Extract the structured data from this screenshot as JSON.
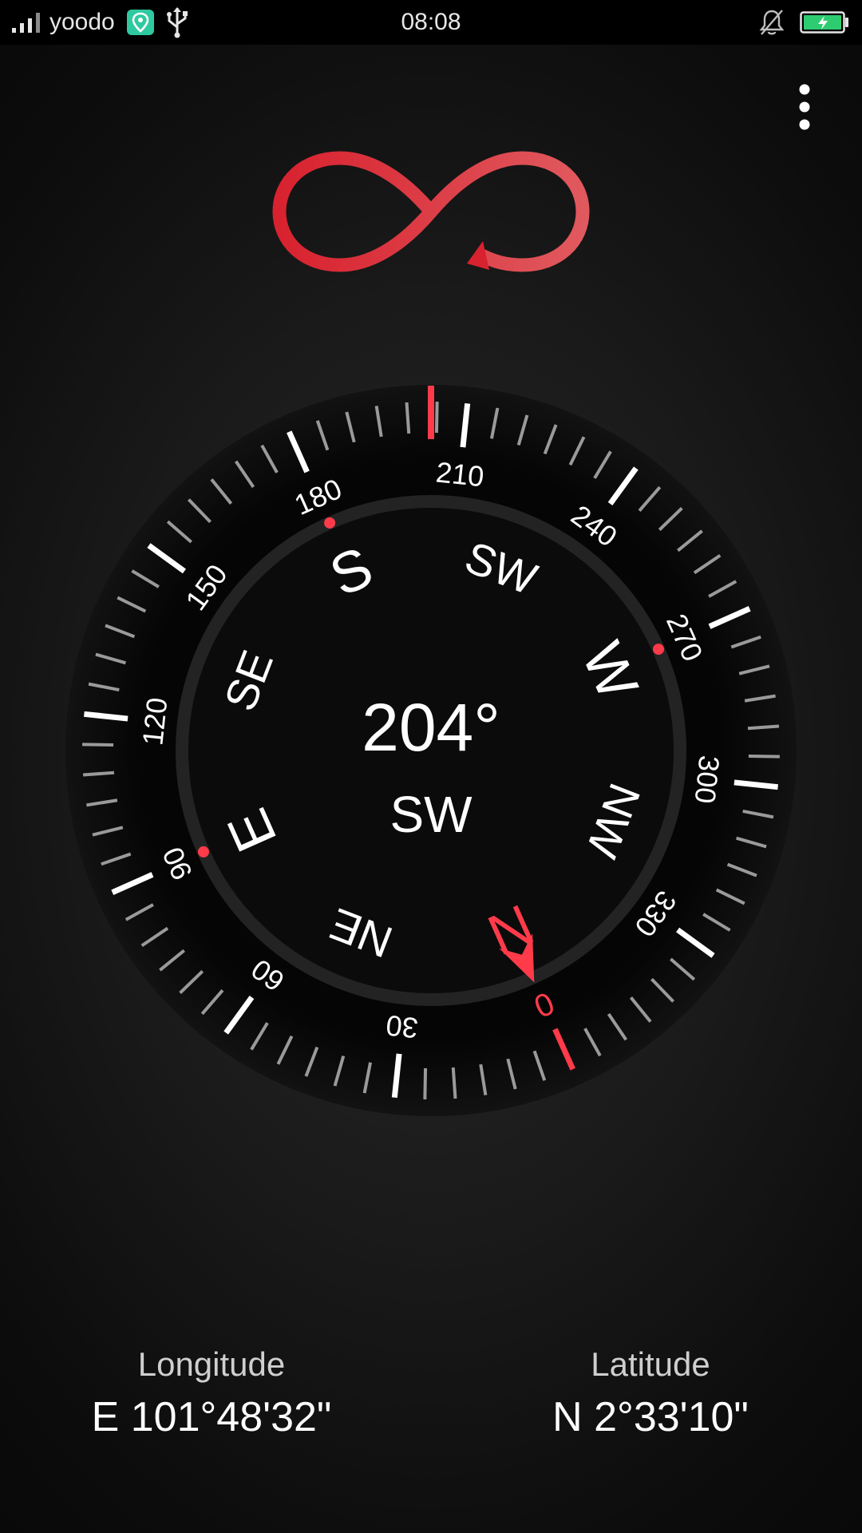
{
  "status_bar": {
    "carrier": "yoodo",
    "time": "08:08",
    "icons": [
      "signal-icon",
      "location-badge-icon",
      "usb-icon",
      "bell-off-icon",
      "battery-charging-icon"
    ],
    "battery_color": "#2ecc71"
  },
  "menu": {
    "icon": "more-vert-icon"
  },
  "logo": {
    "icon": "infinity-arrow-logo",
    "color": "#e0313f"
  },
  "compass": {
    "heading_degrees": 204,
    "heading_display": "204°",
    "direction": "SW",
    "accent_color": "#ff3b4a",
    "degree_labels": [
      "0",
      "30",
      "60",
      "90",
      "120",
      "150",
      "180",
      "210",
      "240",
      "270",
      "300",
      "330"
    ],
    "cardinal_labels": [
      "N",
      "NE",
      "E",
      "SE",
      "S",
      "SW",
      "W",
      "NW"
    ]
  },
  "location": {
    "longitude_label": "Longitude",
    "longitude_value": "E 101°48'32\"",
    "latitude_label": "Latitude",
    "latitude_value": "N 2°33'10\""
  }
}
